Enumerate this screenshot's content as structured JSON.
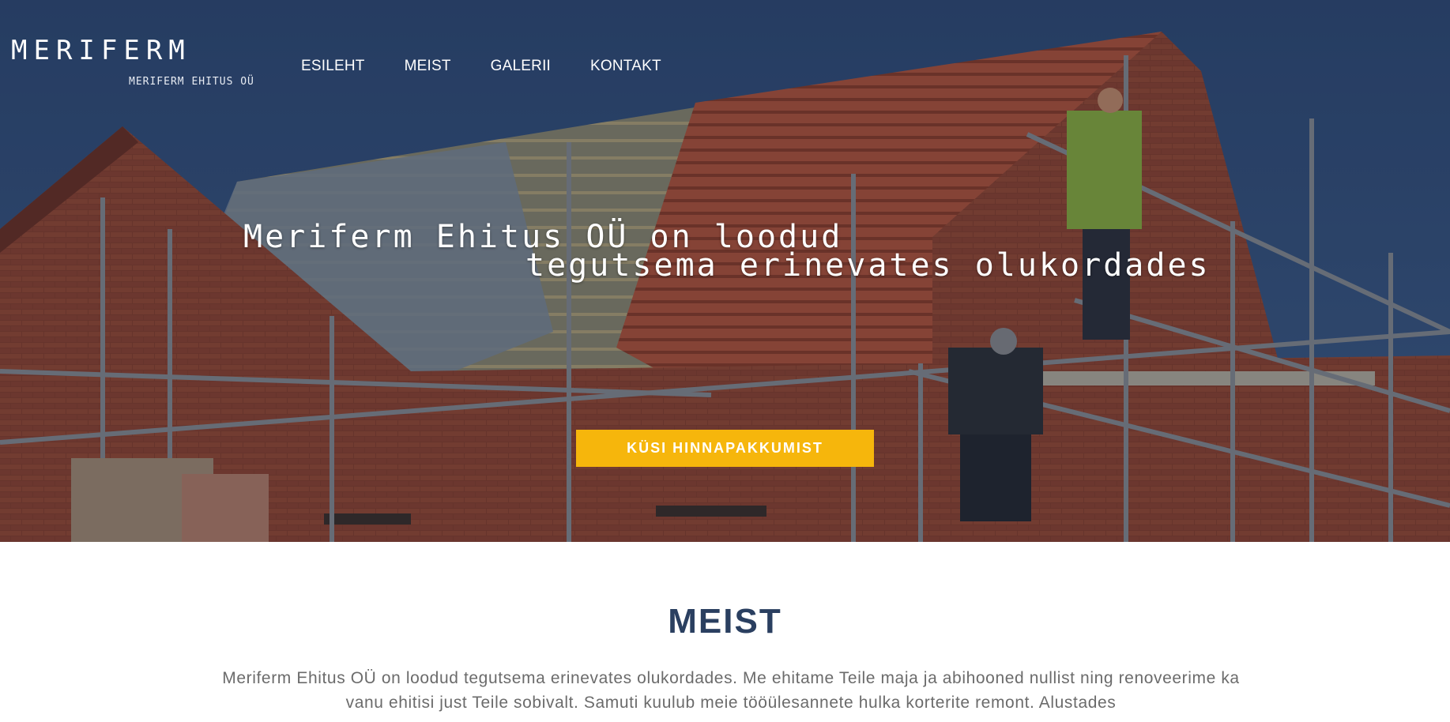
{
  "brand": {
    "name": "MERIFERM",
    "subtitle": "MERIFERM EHITUS OÜ"
  },
  "nav": {
    "items": [
      {
        "label": "ESILEHT"
      },
      {
        "label": "MEIST"
      },
      {
        "label": "GALERII"
      },
      {
        "label": "KONTAKT"
      }
    ]
  },
  "hero": {
    "tagline_line1": "Meriferm Ehitus OÜ on loodud",
    "tagline_line2": "tegutsema erinevates olukordades",
    "cta_label": "KÜSI HINNAPAKKUMIST",
    "background": "construction site – brick house with roof tiles and scaffolding",
    "cta_color": "#f6b60c"
  },
  "about": {
    "title": "MEIST",
    "text": "Meriferm Ehitus OÜ on loodud tegutsema erinevates olukordades. Me ehitame Teile maja ja abihooned nullist ning renoveerime ka vanu ehitisi just Teile sobivalt. Samuti kuulub meie tööülesannete hulka korterite remont. Alustades",
    "title_color": "#2a3f60"
  }
}
